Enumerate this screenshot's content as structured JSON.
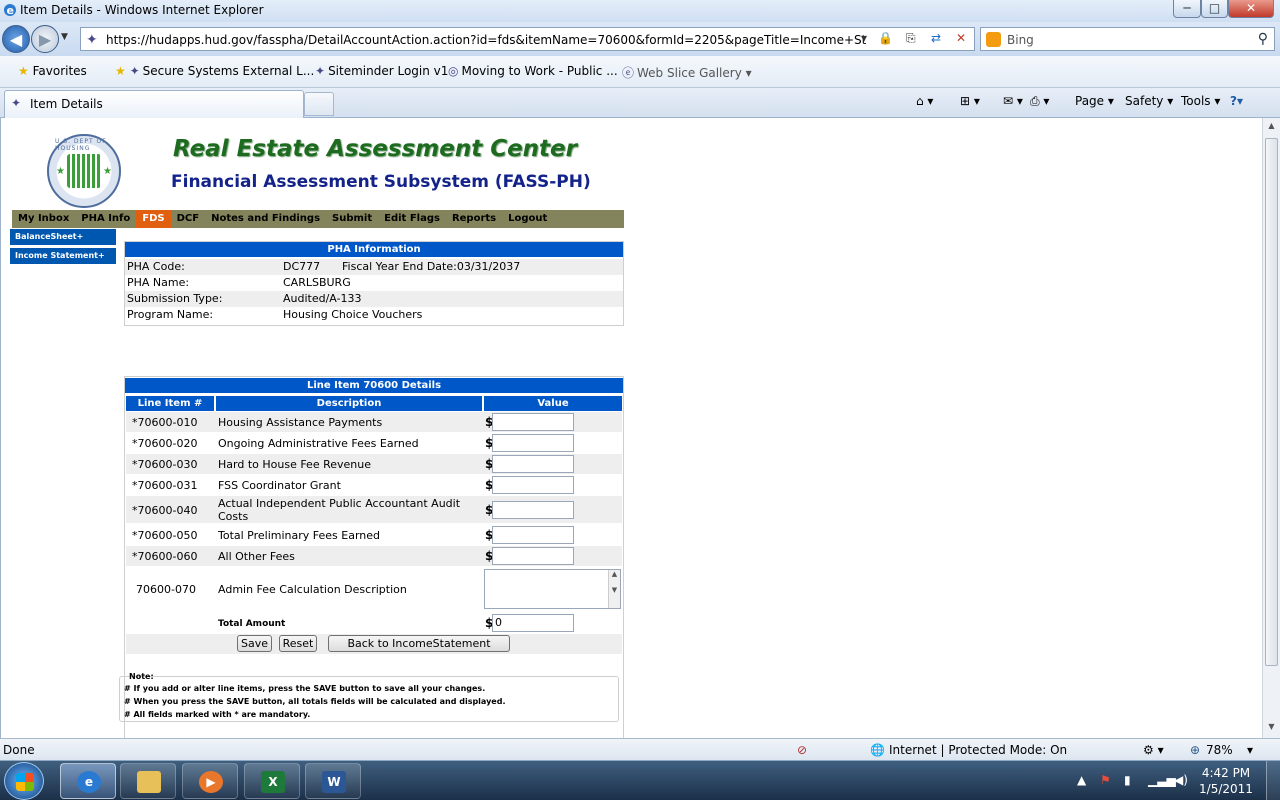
{
  "window": {
    "title": "Item Details - Windows Internet Explorer",
    "minimize": "─",
    "maximize": "□",
    "close": "✕"
  },
  "browser": {
    "url": "https://hudapps.hud.gov/fasspha/DetailAccountAction.action?id=fds&itemName=70600&formId=2205&pageTitle=Income+Statement&am",
    "search_placeholder": "Bing",
    "favorites_label": "Favorites",
    "favorites": [
      "Secure Systems External L...",
      "Siteminder Login v1",
      "Moving to Work - Public ...",
      "Web Slice Gallery ▾"
    ],
    "tab_title": "Item Details",
    "commands": [
      "Page ▾",
      "Safety ▾",
      "Tools ▾"
    ],
    "status_text": "Done",
    "zone_text": "Internet | Protected Mode: On",
    "zoom": "78%"
  },
  "header": {
    "title": "Real Estate Assessment Center",
    "subtitle": "Financial Assessment Subsystem (FASS-PH)"
  },
  "menu": [
    "My Inbox",
    "PHA Info",
    "FDS",
    "DCF",
    "Notes and Findings",
    "Submit",
    "Edit Flags",
    "Reports",
    "Logout"
  ],
  "sidebar": [
    "BalanceSheet+",
    "Income Statement+"
  ],
  "pha_info": {
    "heading": "PHA Information",
    "rows": [
      {
        "label": "PHA Code:",
        "value": "DC777",
        "extra": "Fiscal Year End Date:03/31/2037"
      },
      {
        "label": "PHA Name:",
        "value": "CARLSBURG"
      },
      {
        "label": "Submission Type:",
        "value": "Audited/A-133"
      },
      {
        "label": "Program Name:",
        "value": "Housing Choice Vouchers"
      }
    ]
  },
  "line_item": {
    "heading": "Line Item 70600 Details",
    "columns": [
      "Line Item #",
      "Description",
      "Value"
    ],
    "rows": [
      {
        "code": "*70600-010",
        "desc": "Housing Assistance Payments"
      },
      {
        "code": "*70600-020",
        "desc": "Ongoing Administrative Fees Earned"
      },
      {
        "code": "*70600-030",
        "desc": "Hard to House Fee Revenue"
      },
      {
        "code": "*70600-031",
        "desc": "FSS Coordinator Grant"
      },
      {
        "code": "*70600-040",
        "desc": "Actual Independent Public Accountant Audit Costs"
      },
      {
        "code": "*70600-050",
        "desc": "Total Preliminary Fees Earned"
      },
      {
        "code": "*70600-060",
        "desc": "All Other Fees"
      },
      {
        "code": "70600-070",
        "desc": "Admin Fee Calculation Description"
      }
    ],
    "currency": "$",
    "total_label": "Total Amount",
    "total_value": "0",
    "buttons": {
      "save": "Save",
      "reset": "Reset",
      "back": "Back to IncomeStatement"
    }
  },
  "note": {
    "title": "Note:",
    "lines": [
      "# If you add or alter line items, press the SAVE button to save all your changes.",
      "# When you press the SAVE button, all totals fields will be calculated and displayed.",
      "# All fields marked with * are mandatory."
    ]
  },
  "taskbar": {
    "time": "4:42 PM",
    "date": "1/5/2011"
  }
}
